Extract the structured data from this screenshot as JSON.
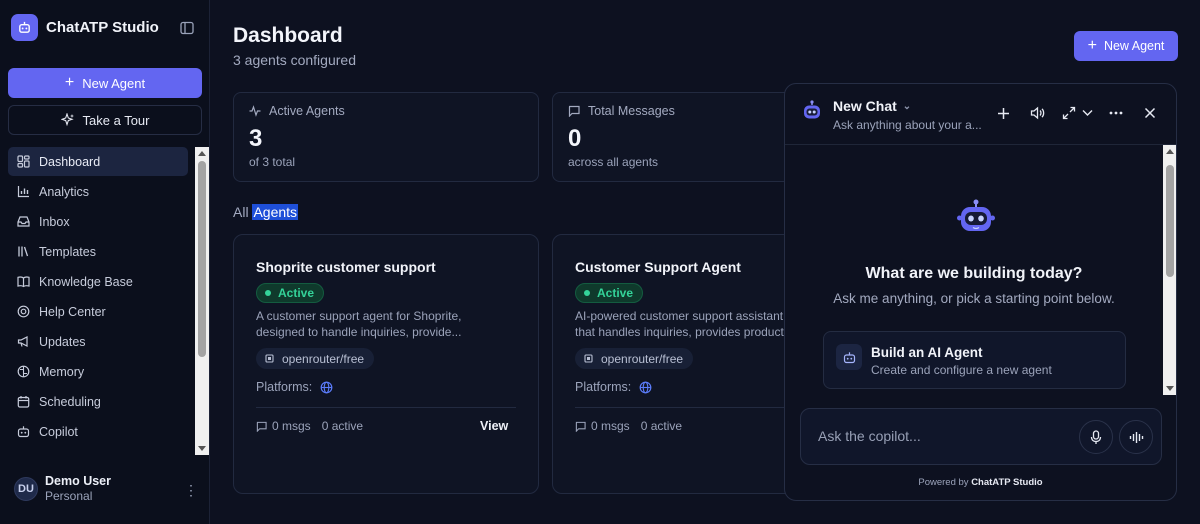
{
  "app": {
    "name": "ChatATP Studio"
  },
  "sidebar": {
    "new_agent_label": "New Agent",
    "tour_label": "Take a Tour",
    "items": [
      {
        "label": "Dashboard",
        "icon": "dashboard-icon",
        "active": true
      },
      {
        "label": "Analytics",
        "icon": "analytics-icon"
      },
      {
        "label": "Inbox",
        "icon": "inbox-icon"
      },
      {
        "label": "Templates",
        "icon": "templates-icon"
      },
      {
        "label": "Knowledge Base",
        "icon": "book-icon"
      },
      {
        "label": "Help Center",
        "icon": "lifebuoy-icon"
      },
      {
        "label": "Updates",
        "icon": "megaphone-icon"
      },
      {
        "label": "Memory",
        "icon": "brain-icon"
      },
      {
        "label": "Scheduling",
        "icon": "calendar-icon"
      },
      {
        "label": "Copilot",
        "icon": "bot-icon"
      }
    ],
    "user": {
      "initials": "DU",
      "name": "Demo User",
      "workspace": "Personal"
    }
  },
  "header": {
    "title": "Dashboard",
    "subtitle": "3 agents configured",
    "new_agent_label": "New Agent"
  },
  "stats": [
    {
      "label": "Active Agents",
      "value": "3",
      "sub": "of 3 total",
      "icon": "activity-icon"
    },
    {
      "label": "Total Messages",
      "value": "0",
      "sub": "across all agents",
      "icon": "message-icon"
    }
  ],
  "section": {
    "prefix": "All",
    "highlight": "Agents"
  },
  "agents": [
    {
      "name": "Shoprite customer support",
      "status": "Active",
      "desc_line1": "A customer support agent for Shoprite,",
      "desc_line2": "designed to handle inquiries, provide...",
      "model": "openrouter/free",
      "platforms_label": "Platforms:",
      "msgs": "0 msgs",
      "active": "0 active",
      "view_label": "View"
    },
    {
      "name": "Customer Support Agent",
      "status": "Active",
      "desc_line1": "AI-powered customer support assistant",
      "desc_line2": "that handles inquiries, provides product",
      "model": "openrouter/free",
      "platforms_label": "Platforms:",
      "msgs": "0 msgs",
      "active": "0 active"
    }
  ],
  "chat": {
    "title": "New Chat",
    "subtitle": "Ask anything about your a...",
    "welcome_title": "What are we building today?",
    "welcome_sub": "Ask me anything, or pick a starting point below.",
    "suggestion_title": "Build an AI Agent",
    "suggestion_sub": "Create and configure a new agent",
    "input_placeholder": "Ask the copilot...",
    "powered_prefix": "Powered by",
    "powered_brand": "ChatATP Studio"
  },
  "colors": {
    "accent": "#6366f1",
    "success": "#34d399",
    "background": "#0d1120"
  }
}
